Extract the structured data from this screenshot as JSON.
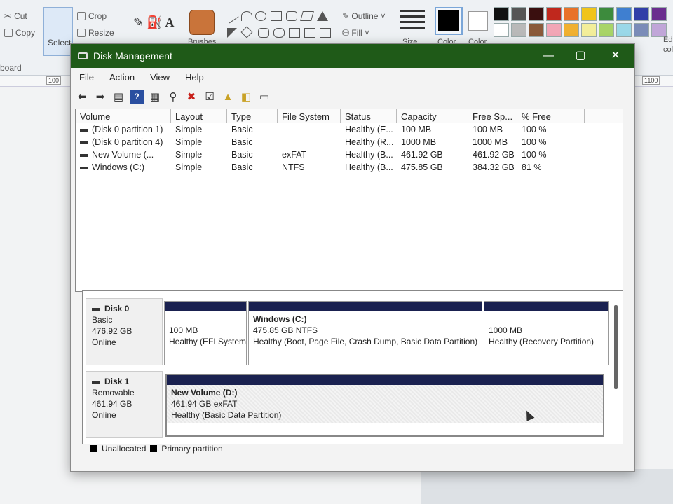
{
  "paint": {
    "ribbon": {
      "cut": "Cut",
      "copy": "Copy",
      "crop": "Crop",
      "resize": "Resize",
      "select": "Select",
      "brushes": "Brushes",
      "outline": "Outline",
      "fill": "Fill",
      "size": "Size",
      "color1": "Color",
      "color2": "Color",
      "edit_colors": "Ed\ncolo",
      "clipboard": "board"
    },
    "ruler": {
      "left": "100",
      "right": "1100"
    },
    "palette": [
      "#111111",
      "#555555",
      "#3a0f0f",
      "#c0281d",
      "#e8722a",
      "#f0c419",
      "#3d8b3d",
      "#3f7fd0",
      "#323fa8",
      "#6a2d8e",
      "#ffffff",
      "#b9b9b9",
      "#8a5a3a",
      "#f2a6b6",
      "#f0b030",
      "#f3ee9a",
      "#a8d468",
      "#9ad8e8",
      "#7a8cb8",
      "#c0a6d8"
    ]
  },
  "window": {
    "title": "Disk Management",
    "minimize": "—",
    "maximize": "▢",
    "close": "✕"
  },
  "menu": {
    "file": "File",
    "action": "Action",
    "view": "View",
    "help": "Help"
  },
  "toolbar_icons": [
    "back-icon",
    "forward-icon",
    "console-icon",
    "help-icon",
    "properties-icon",
    "connect-icon",
    "delete-icon",
    "check-icon",
    "folder-up-icon",
    "folder-search-icon",
    "export-icon"
  ],
  "volume_list": {
    "headers": {
      "volume": "Volume",
      "layout": "Layout",
      "type": "Type",
      "fs": "File System",
      "status": "Status",
      "capacity": "Capacity",
      "free": "Free Sp...",
      "pct": "% Free"
    },
    "rows": [
      {
        "volume": "(Disk 0 partition 1)",
        "layout": "Simple",
        "type": "Basic",
        "fs": "",
        "status": "Healthy (E...",
        "capacity": "100 MB",
        "free": "100 MB",
        "pct": "100 %"
      },
      {
        "volume": "(Disk 0 partition 4)",
        "layout": "Simple",
        "type": "Basic",
        "fs": "",
        "status": "Healthy (R...",
        "capacity": "1000 MB",
        "free": "1000 MB",
        "pct": "100 %"
      },
      {
        "volume": "New Volume (...",
        "layout": "Simple",
        "type": "Basic",
        "fs": "exFAT",
        "status": "Healthy (B...",
        "capacity": "461.92 GB",
        "free": "461.92 GB",
        "pct": "100 %"
      },
      {
        "volume": "Windows (C:)",
        "layout": "Simple",
        "type": "Basic",
        "fs": "NTFS",
        "status": "Healthy (B...",
        "capacity": "475.85 GB",
        "free": "384.32 GB",
        "pct": "81 %"
      }
    ]
  },
  "disks": [
    {
      "name": "Disk 0",
      "type": "Basic",
      "size": "476.92 GB",
      "state": "Online",
      "partitions": [
        {
          "name": "",
          "line1": "100 MB",
          "line2": "Healthy (EFI System"
        },
        {
          "name": "Windows  (C:)",
          "line1": "475.85 GB NTFS",
          "line2": "Healthy (Boot, Page File, Crash Dump, Basic Data Partition)"
        },
        {
          "name": "",
          "line1": "1000 MB",
          "line2": "Healthy (Recovery Partition)"
        }
      ]
    },
    {
      "name": "Disk 1",
      "type": "Removable",
      "size": "461.94 GB",
      "state": "Online",
      "partitions": [
        {
          "name": "New Volume  (D:)",
          "line1": "461.94 GB exFAT",
          "line2": "Healthy (Basic Data Partition)"
        }
      ]
    }
  ],
  "legend": {
    "unallocated": "Unallocated",
    "primary": "Primary partition"
  },
  "colors": {
    "title_bar": "#1f5a18",
    "partition_bar": "#1a2150"
  }
}
